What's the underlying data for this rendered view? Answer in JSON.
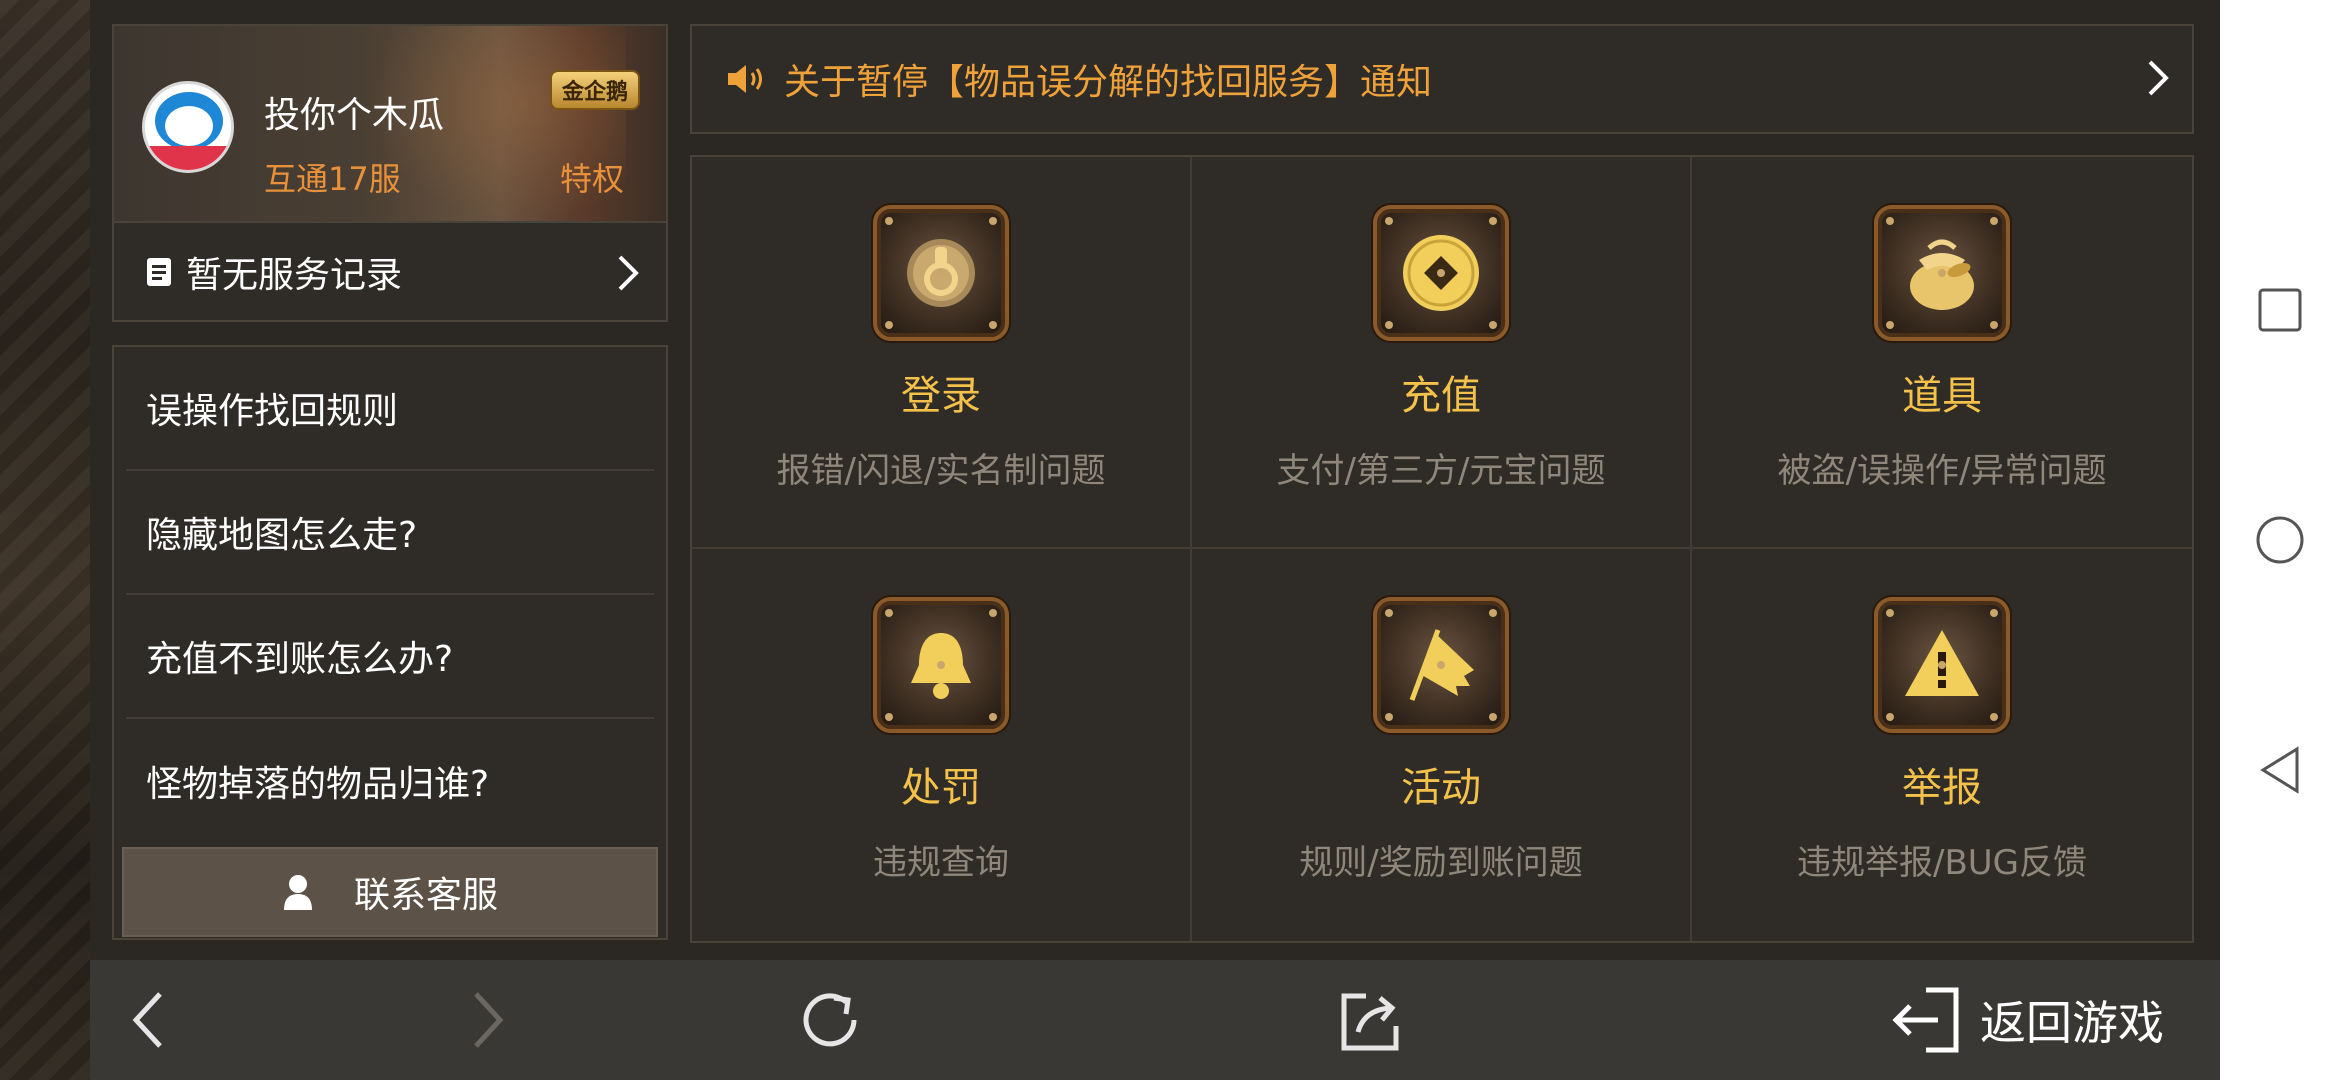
{
  "profile": {
    "username": "投你个木瓜",
    "server": "互通17服",
    "vip_badge": "金企鹅",
    "privilege": "特权",
    "service_record": "暂无服务记录"
  },
  "notice": {
    "text": "关于暂停【物品误分解的找回服务】通知"
  },
  "faq": {
    "items": [
      {
        "label": "误操作找回规则"
      },
      {
        "label": "隐藏地图怎么走?"
      },
      {
        "label": "充值不到账怎么办?"
      },
      {
        "label": "怪物掉落的物品归谁?"
      }
    ],
    "contact": "联系客服"
  },
  "services": [
    {
      "title": "登录",
      "subtitle": "报错/闪退/实名制问题",
      "icon": "door-knocker-icon"
    },
    {
      "title": "充值",
      "subtitle": "支付/第三方/元宝问题",
      "icon": "coin-icon"
    },
    {
      "title": "道具",
      "subtitle": "被盗/误操作/异常问题",
      "icon": "treasure-bag-icon"
    },
    {
      "title": "处罚",
      "subtitle": "违规查询",
      "icon": "bell-icon"
    },
    {
      "title": "活动",
      "subtitle": "规则/奖励到账问题",
      "icon": "flag-icon"
    },
    {
      "title": "举报",
      "subtitle": "违规举报/BUG反馈",
      "icon": "warning-icon"
    }
  ],
  "bottom_bar": {
    "back_to_game": "返回游戏"
  },
  "colors": {
    "accent_orange": "#e8913a",
    "title_gold": "#f4c24a",
    "panel_bg": "#2f2b26",
    "border": "#4a433a"
  }
}
